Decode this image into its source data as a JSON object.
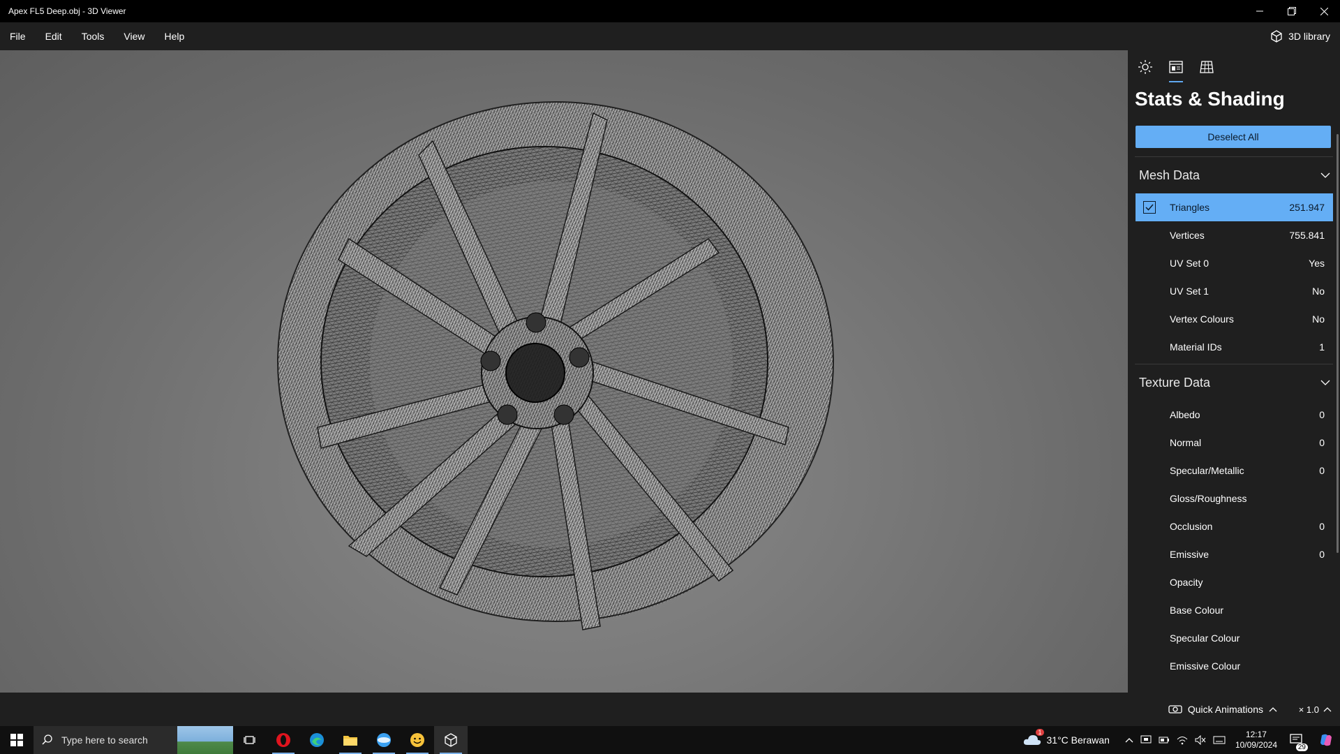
{
  "window": {
    "title": "Apex FL5 Deep.obj - 3D Viewer"
  },
  "menu": {
    "items": [
      "File",
      "Edit",
      "Tools",
      "View",
      "Help"
    ],
    "library_label": "3D library"
  },
  "panel": {
    "tabs": [
      "sun-icon",
      "stats-icon",
      "grid-icon"
    ],
    "active_tab": "stats-icon",
    "title": "Stats & Shading",
    "deselect_label": "Deselect All",
    "mesh_section": "Mesh Data",
    "mesh_rows": [
      {
        "label": "Triangles",
        "value": "251.947",
        "selected": true
      },
      {
        "label": "Vertices",
        "value": "755.841"
      },
      {
        "label": "UV Set 0",
        "value": "Yes"
      },
      {
        "label": "UV Set 1",
        "value": "No"
      },
      {
        "label": "Vertex Colours",
        "value": "No"
      },
      {
        "label": "Material IDs",
        "value": "1"
      }
    ],
    "texture_section": "Texture Data",
    "texture_rows": [
      {
        "label": "Albedo",
        "value": "0"
      },
      {
        "label": "Normal",
        "value": "0"
      },
      {
        "label": "Specular/Metallic",
        "value": "0"
      },
      {
        "label": "Gloss/Roughness",
        "value": ""
      },
      {
        "label": "Occlusion",
        "value": "0"
      },
      {
        "label": "Emissive",
        "value": "0"
      },
      {
        "label": "Opacity",
        "value": ""
      },
      {
        "label": "Base Colour",
        "value": ""
      },
      {
        "label": "Specular Colour",
        "value": ""
      },
      {
        "label": "Emissive Colour",
        "value": ""
      }
    ],
    "accent": "#64aef5"
  },
  "status": {
    "quick_animations": "Quick Animations",
    "speed": "× 1.0"
  },
  "taskbar": {
    "search_placeholder": "Type here to search",
    "apps": [
      "task-view-icon",
      "opera-icon",
      "edge-icon",
      "file-explorer-icon",
      "app-icon",
      "emoji-app-icon",
      "3d-viewer-icon"
    ],
    "weather": "31°C  Berawan",
    "weather_alert": "1",
    "time": "12:17",
    "date": "10/09/2024",
    "notification_count": "29"
  }
}
